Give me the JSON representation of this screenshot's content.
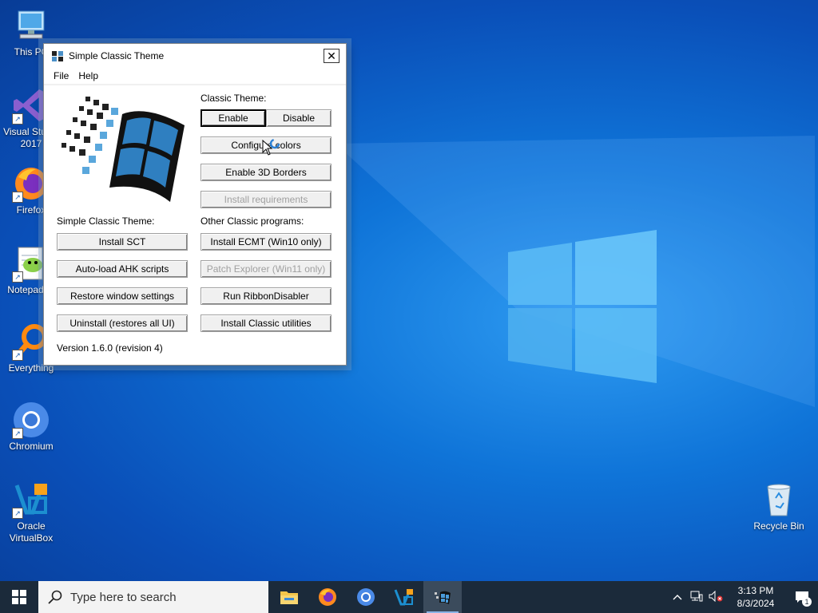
{
  "window": {
    "title": "Simple Classic Theme",
    "close_label": "✕",
    "menu": [
      "File",
      "Help"
    ]
  },
  "classic_theme": {
    "heading": "Classic Theme:",
    "enable": "Enable",
    "disable": "Disable",
    "configure_colors": "Configure colors",
    "enable_3d_borders": "Enable 3D Borders",
    "install_requirements": "Install requirements"
  },
  "simple_classic_theme": {
    "heading": "Simple Classic Theme:",
    "install_sct": "Install SCT",
    "autoload_ahk": "Auto-load AHK scripts",
    "restore_window": "Restore window settings",
    "uninstall": "Uninstall (restores all UI)"
  },
  "other_programs": {
    "heading": "Other Classic programs:",
    "install_ecmt": "Install ECMT (Win10 only)",
    "patch_explorer": "Patch Explorer (Win11 only)",
    "run_ribbon": "Run RibbonDisabler",
    "install_utilities": "Install Classic utilities"
  },
  "version": "Version 1.6.0 (revision 4)",
  "desktop_icons": [
    {
      "label": "This PC",
      "icon": "computer-icon"
    },
    {
      "label": "Visual Studio 2017",
      "icon": "visual-studio-icon"
    },
    {
      "label": "Firefox",
      "icon": "firefox-icon"
    },
    {
      "label": "Notepad++",
      "icon": "notepad-plus-plus-icon"
    },
    {
      "label": "Everything",
      "icon": "everything-search-icon"
    },
    {
      "label": "Chromium",
      "icon": "chromium-icon"
    },
    {
      "label": "Oracle VirtualBox",
      "icon": "virtualbox-icon"
    },
    {
      "label": "Recycle Bin",
      "icon": "recycle-bin-icon"
    }
  ],
  "taskbar": {
    "search_placeholder": "Type here to search",
    "apps": [
      "file-explorer-icon",
      "firefox-icon",
      "chromium-icon",
      "virtualbox-icon",
      "simple-classic-theme-icon"
    ],
    "clock_time": "3:13 PM",
    "clock_date": "8/3/2024",
    "notification_count": "1"
  },
  "colors": {
    "accent": "#0a64d6",
    "taskbar": "#1b2a3a",
    "window_bg": "#f0f0f0"
  }
}
